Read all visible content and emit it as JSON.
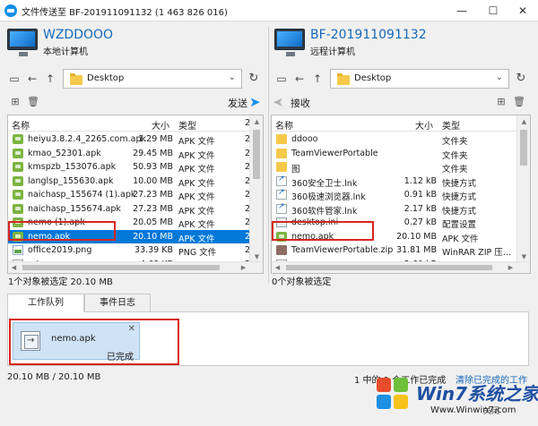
{
  "window": {
    "title": "文件传送至 BF-201911091132 (1 463 826 016)",
    "minimize": "—",
    "maximize": "☐",
    "close": "✕"
  },
  "local": {
    "name": "WZDDOOO",
    "subtitle": "本地计算机",
    "path": "Desktop",
    "send_label": "发送",
    "columns": {
      "name": "名称",
      "size": "大小",
      "type": "类型",
      "date": "2"
    },
    "files": [
      {
        "name": "heiyu3.8.2.4_2265.com.apk",
        "size": "1.29 MB",
        "type": "APK 文件",
        "date": "2",
        "icon": "apk"
      },
      {
        "name": "kmao_52301.apk",
        "size": "29.45 MB",
        "type": "APK 文件",
        "date": "2",
        "icon": "apk"
      },
      {
        "name": "kmspzb_153076.apk",
        "size": "50.93 MB",
        "type": "APK 文件",
        "date": "2",
        "icon": "apk"
      },
      {
        "name": "langlsp_155630.apk",
        "size": "10.00 MB",
        "type": "APK 文件",
        "date": "2",
        "icon": "apk"
      },
      {
        "name": "naichasp_155674 (1).apk",
        "size": "27.23 MB",
        "type": "APK 文件",
        "date": "2",
        "icon": "apk"
      },
      {
        "name": "naichasp_155674.apk",
        "size": "27.23 MB",
        "type": "APK 文件",
        "date": "2",
        "icon": "apk"
      },
      {
        "name": "nemo (1).apk",
        "size": "20.05 MB",
        "type": "APK 文件",
        "date": "2",
        "icon": "apk"
      },
      {
        "name": "nemo.apk",
        "size": "20.10 MB",
        "type": "APK 文件",
        "date": "2",
        "icon": "apk",
        "selected": true
      },
      {
        "name": "office2019.png",
        "size": "33.39 KB",
        "type": "PNG 文件",
        "date": "2",
        "icon": "img"
      },
      {
        "name": "…t",
        "size": "4.68 KB",
        "type": "文本文档",
        "date": "2",
        "icon": "txt"
      }
    ],
    "status": "1个对象被选定 20.10 MB"
  },
  "remote": {
    "name": "BF-201911091132",
    "subtitle": "远程计算机",
    "path": "Desktop",
    "receive_label": "接收",
    "columns": {
      "name": "名称",
      "size": "大小",
      "type": "类型"
    },
    "files": [
      {
        "name": "ddooo",
        "size": "",
        "type": "文件夹",
        "icon": "folder"
      },
      {
        "name": "TeamViewerPortable",
        "size": "",
        "type": "文件夹",
        "icon": "folder"
      },
      {
        "name": "图",
        "size": "",
        "type": "文件夹",
        "icon": "folder"
      },
      {
        "name": "360安全卫士.lnk",
        "size": "1.12 kB",
        "type": "快捷方式",
        "icon": "lnk"
      },
      {
        "name": "360极速浏览器.lnk",
        "size": "0.91 kB",
        "type": "快捷方式",
        "icon": "lnk"
      },
      {
        "name": "360软件管家.lnk",
        "size": "2.17 kB",
        "type": "快捷方式",
        "icon": "lnk"
      },
      {
        "name": "desktop.ini",
        "size": "0.27 kB",
        "type": "配置设置",
        "icon": "cfg"
      },
      {
        "name": "nemo.apk",
        "size": "20.10 MB",
        "type": "APK 文件",
        "icon": "apk"
      },
      {
        "name": "TeamViewerPortable.zip",
        "size": "31.81 MB",
        "type": "WinRAR ZIP 压…",
        "icon": "zip"
      },
      {
        "name": "…",
        "size": "2.60 kB",
        "type": "文本文档",
        "icon": "txt"
      }
    ],
    "status": "0个对象被选定"
  },
  "tabs": [
    {
      "label": "工作队列",
      "active": true
    },
    {
      "label": "事件日志",
      "active": false
    }
  ],
  "job": {
    "name": "nemo.apk",
    "status": "已完成",
    "close": "✕"
  },
  "footer": {
    "progress": "20.10 MB / 20.10 MB",
    "jobs_done": "1 中的 1 个工作已完成",
    "clear_link": "清除已完成的工作"
  },
  "watermark": {
    "brand": "Win7系统之家",
    "url": "Www.Winwin7.com",
    "close_hint": "关闭"
  },
  "colors": {
    "accent": "#0078d7",
    "highlight": "#d6261f",
    "link": "#1769b8"
  }
}
